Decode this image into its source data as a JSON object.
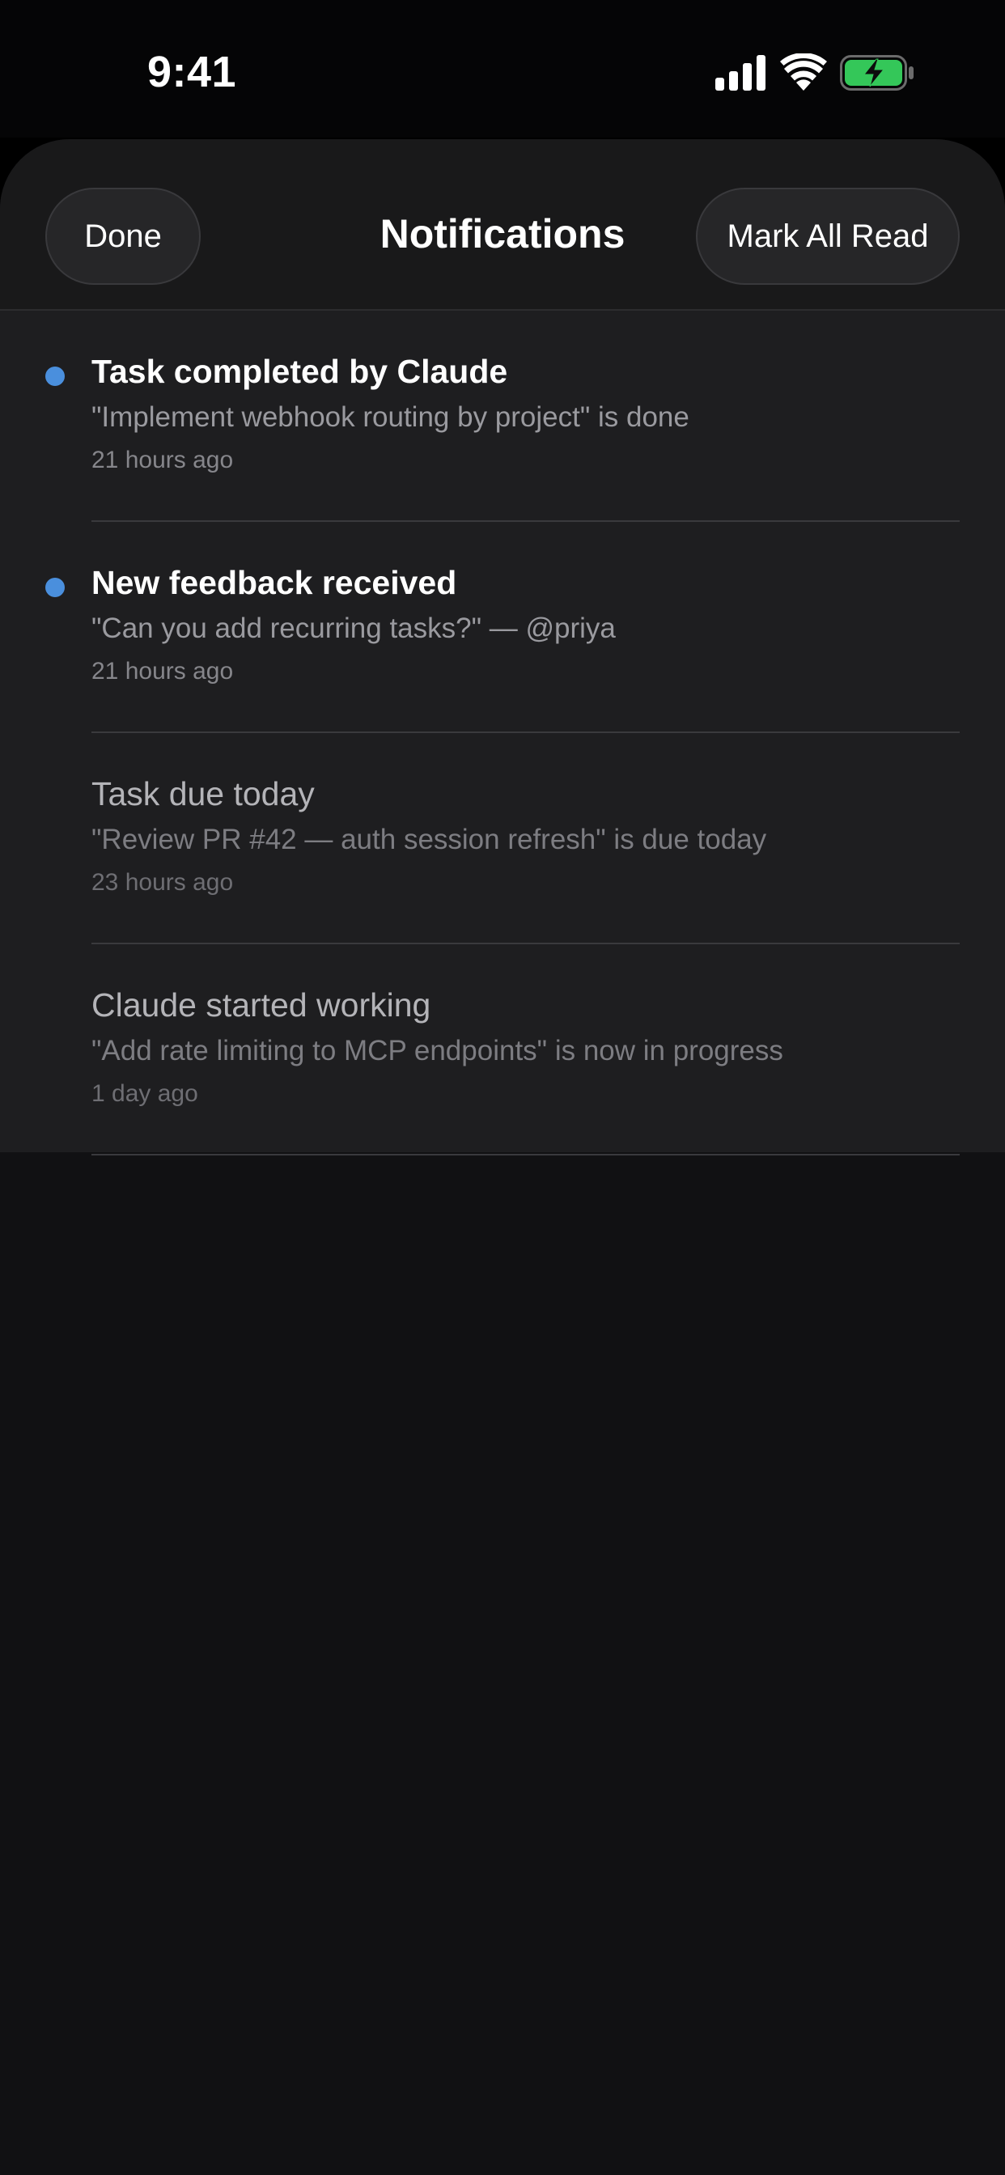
{
  "status_bar": {
    "time": "9:41",
    "icons": [
      "cellular-signal-icon",
      "wifi-icon",
      "battery-charging-icon"
    ],
    "battery_color": "#34c759"
  },
  "header": {
    "done_label": "Done",
    "title": "Notifications",
    "mark_all_read_label": "Mark All Read"
  },
  "colors": {
    "unread_dot": "#4a8fdd"
  },
  "notifications": [
    {
      "title": "Task completed by Claude",
      "body": "\"Implement webhook routing by project\" is done",
      "time": "21 hours ago",
      "unread": true
    },
    {
      "title": "New feedback received",
      "body": "\"Can you add recurring tasks?\" — @priya",
      "time": "21 hours ago",
      "unread": true
    },
    {
      "title": "Task due today",
      "body": "\"Review PR #42 — auth session refresh\" is due today",
      "time": "23 hours ago",
      "unread": false
    },
    {
      "title": "Claude started working",
      "body": "\"Add rate limiting to MCP endpoints\" is now in progress",
      "time": "1 day ago",
      "unread": false
    }
  ]
}
